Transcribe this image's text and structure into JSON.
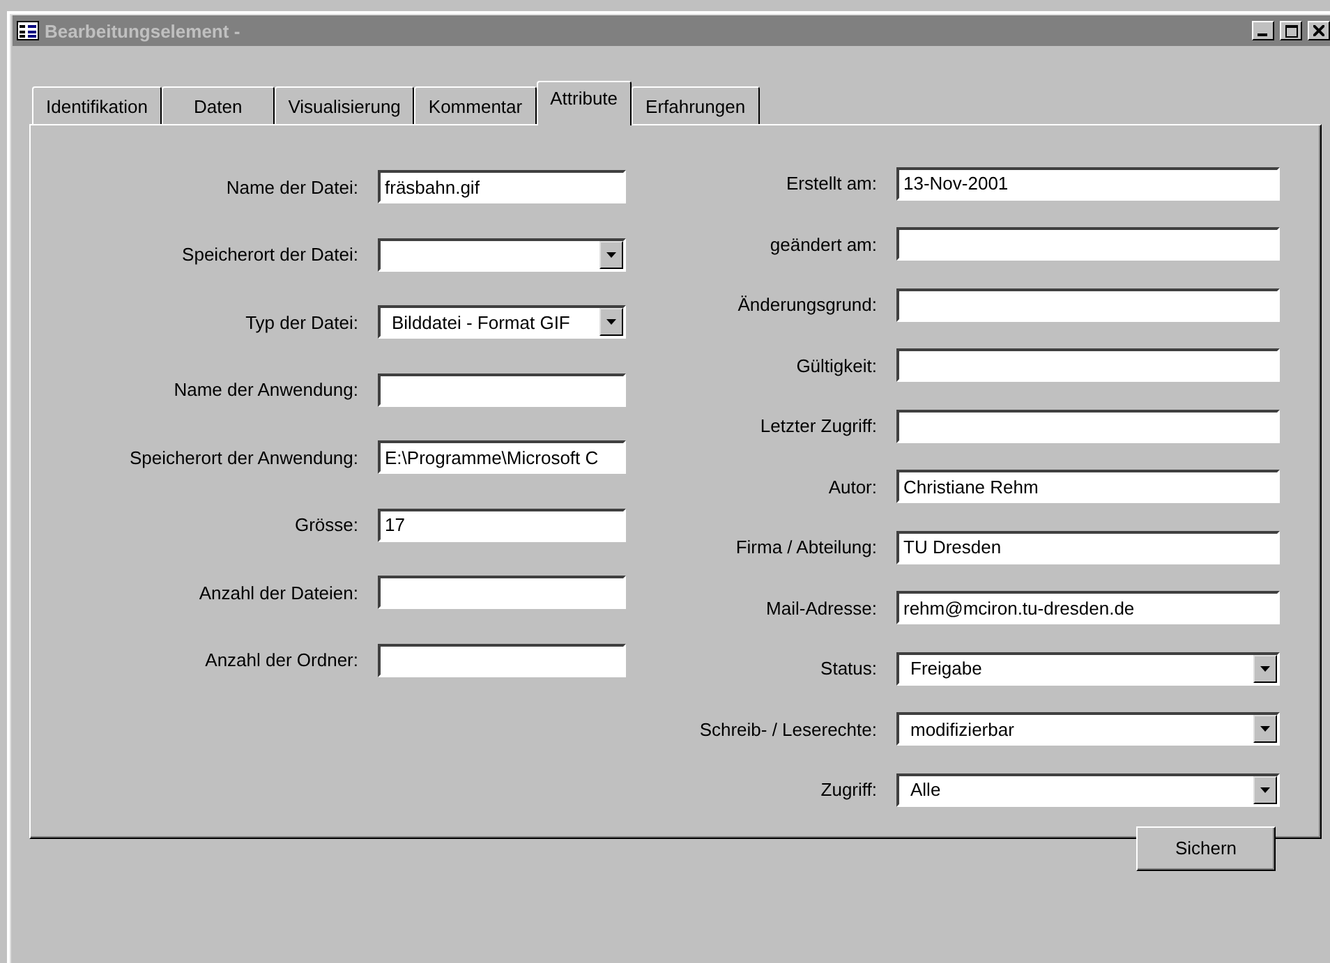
{
  "window": {
    "title": "Bearbeitungselement -"
  },
  "tabs": [
    {
      "label": "Identifikation",
      "selected": false
    },
    {
      "label": "Daten",
      "selected": false
    },
    {
      "label": "Visualisierung",
      "selected": false
    },
    {
      "label": "Kommentar",
      "selected": false
    },
    {
      "label": "Attribute",
      "selected": true
    },
    {
      "label": "Erfahrungen",
      "selected": false
    }
  ],
  "left_fields": [
    {
      "label": "Name der Datei:",
      "kind": "text",
      "value": "fräsbahn.gif"
    },
    {
      "label": "Speicherort der Datei:",
      "kind": "dropdown"
    },
    {
      "label": "Typ der Datei:",
      "kind": "dropdown",
      "value": "Bilddatei - Format GIF"
    },
    {
      "label": "Name der Anwendung:",
      "kind": "text"
    },
    {
      "label": "Speicherort der Anwendung:",
      "kind": "text",
      "value": "E:\\Programme\\Microsoft C"
    },
    {
      "label": "Grösse:",
      "kind": "text",
      "value": "17"
    },
    {
      "label": "Anzahl der Dateien:",
      "kind": "text"
    },
    {
      "label": "Anzahl der Ordner:",
      "kind": "text"
    }
  ],
  "right_fields": [
    {
      "label": "Erstellt am:",
      "kind": "text",
      "value": "13-Nov-2001"
    },
    {
      "label": "geändert am:",
      "kind": "text"
    },
    {
      "label": "Änderungsgrund:",
      "kind": "text"
    },
    {
      "label": "Gültigkeit:",
      "kind": "text"
    },
    {
      "label": "Letzter Zugriff:",
      "kind": "text"
    },
    {
      "label": "Autor:",
      "kind": "text",
      "value": "Christiane Rehm"
    },
    {
      "label": "Firma / Abteilung:",
      "kind": "text",
      "value": "TU Dresden"
    },
    {
      "label": "Mail-Adresse:",
      "kind": "text",
      "value": "rehm@mciron.tu-dresden.de"
    },
    {
      "label": "Status:",
      "kind": "dropdown",
      "value": "Freigabe"
    },
    {
      "label": "Schreib- / Leserechte:",
      "kind": "dropdown",
      "value": "modifizierbar"
    },
    {
      "label": "Zugriff:",
      "kind": "dropdown",
      "value": "Alle"
    }
  ],
  "buttons": [
    "Sichern"
  ]
}
